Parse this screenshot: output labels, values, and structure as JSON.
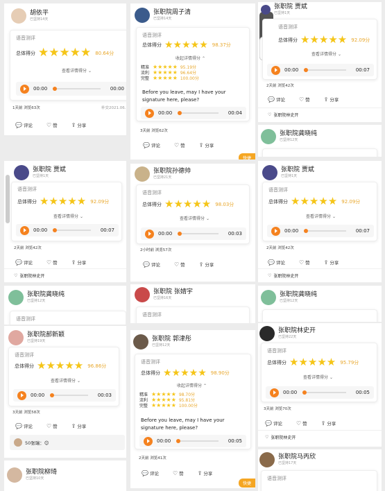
{
  "ui": {
    "voice": "语音测评",
    "total": "总体得分",
    "view": "查看详情得分",
    "collapse": "收起详情得分",
    "comment": "评论",
    "like": "赞",
    "share": "分享",
    "acc": "精准",
    "flu": "流利",
    "comp": "完整",
    "t0": "00:00",
    "sentence": "Before you leave, may I have your signature here, please?"
  },
  "p1": {
    "name": "胡依平",
    "sub": "已坚持14天",
    "score": "80.64分",
    "end": "00:00",
    "stats": "1天前 浏览63次",
    "date": "补交2021.06."
  },
  "p2": {
    "name": "张职院周子清",
    "sub": "已坚持14天",
    "score": "98.37分",
    "acc": "95.19分",
    "flu": "96.64分",
    "comp": "100.00分",
    "end": "00:04",
    "stats": "3天前 浏览62次",
    "tag": "快捷"
  },
  "p3": {
    "name": "张职院 贾斌",
    "sub": "已坚持1天",
    "score": "92.09分",
    "end": "00:07",
    "stats": "2天前 浏览42次",
    "footer": "张职院林史开"
  },
  "p4": {
    "name": "张职院龚晓纯",
    "sub": "已坚持12天"
  },
  "p5": {
    "name": "张职院 贾斌",
    "sub": "已坚持1天",
    "score": "92.09分",
    "end": "00:07",
    "stats": "2天前 浏览42次",
    "footer": "张职院林史开"
  },
  "p6": {
    "name": "张职院孙德帅",
    "sub": "已坚持21天",
    "score": "98.03分",
    "end": "00:03",
    "stats": "2小时前 浏览57次"
  },
  "p7": {
    "name": "张职院 贾斌",
    "sub": "已坚持1天",
    "score": "92.09分",
    "end": "00:07",
    "stats": "2天前 浏览42次",
    "footer": "张职院林史开"
  },
  "p8": {
    "name": "张职院龚晓纯",
    "sub": "已坚持12天"
  },
  "p9": {
    "name": "张职院 张婧宇",
    "sub": "已坚持16天"
  },
  "p10": {
    "name": "张职院龚晓纯",
    "sub": "已坚持12天"
  },
  "p11": {
    "name": "张职院郝新颖",
    "sub": "已坚持19天",
    "score": "96.86分",
    "end": "00:03",
    "stats": "3天前 浏览58次",
    "reply": "50张瑞：😊"
  },
  "p12": {
    "name": "张职院 郭津彤",
    "sub": "已坚持12天",
    "score": "98.90分",
    "acc": "98.70分",
    "flu": "95.81分",
    "comp": "100.00分",
    "end": "00:05",
    "stats": "2天前 浏览41次",
    "tag": "快捷"
  },
  "p13": {
    "name": "张职院林史开",
    "sub": "已坚持22天",
    "score": "95.79分",
    "end": "00:05",
    "stats": "3天前 浏览70次",
    "footer": "张职院林史开"
  },
  "p14": {
    "name": "张职院柳琦",
    "sub": "已坚持10天"
  },
  "p15": {
    "name": "张职院马丙欣",
    "sub": "已坚持17天"
  },
  "colors": {
    "accent": "#f5821f",
    "star": "#f5c518",
    "scoreText": "#e8a72b"
  }
}
